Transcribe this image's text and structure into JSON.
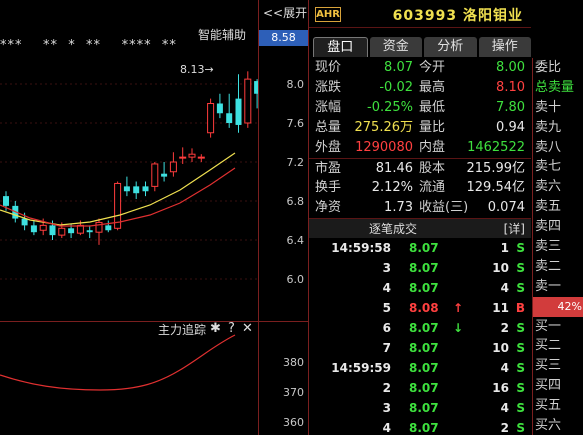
{
  "chart": {
    "indicator_label": "智能辅助",
    "star_row": "***    **  *  **    ****  **",
    "price_marker": "8.13→",
    "current_price_tag": "8.58",
    "collapse_label": "<<展开",
    "y_labels": [
      "8.0",
      "7.6",
      "7.2",
      "6.8",
      "6.4",
      "6.0"
    ],
    "sub_title": "主力追踪",
    "sub_icons": [
      "gear-icon",
      "help-icon",
      "close-icon"
    ],
    "sub_icon_glyphs": [
      "✱",
      "?",
      "✕"
    ],
    "sub_y_labels": [
      "380",
      "370",
      "360"
    ],
    "colors": {
      "up": "#ff3c3c",
      "down": "#3ee0e0",
      "ma_yellow": "#f0e050",
      "ma_red": "#e03030",
      "grid": "#7a1f1f"
    }
  },
  "header": {
    "badge": "AHR",
    "stock_code": "603993",
    "stock_name": "洛阳钼业"
  },
  "tabs": [
    {
      "label": "盘口",
      "active": true
    },
    {
      "label": "资金",
      "active": false
    },
    {
      "label": "分析",
      "active": false
    },
    {
      "label": "操作",
      "active": false
    }
  ],
  "quote": {
    "rows": [
      {
        "l1": "现价",
        "v1": "8.07",
        "c1": "green",
        "l2": "今开",
        "v2": "8.00",
        "c2": "green"
      },
      {
        "l1": "涨跌",
        "v1": "-0.02",
        "c1": "green",
        "l2": "最高",
        "v2": "8.10",
        "c2": "red"
      },
      {
        "l1": "涨幅",
        "v1": "-0.25%",
        "c1": "green",
        "l2": "最低",
        "v2": "7.80",
        "c2": "green"
      },
      {
        "l1": "总量",
        "v1": "275.26万",
        "c1": "yellow",
        "l2": "量比",
        "v2": "0.94",
        "c2": "white"
      },
      {
        "l1": "外盘",
        "v1": "1290080",
        "c1": "red",
        "l2": "内盘",
        "v2": "1462522",
        "c2": "green"
      },
      {
        "l1": "市盈",
        "v1": "81.46",
        "c1": "white",
        "l2": "股本",
        "v2": "215.99亿",
        "c2": "white"
      },
      {
        "l1": "换手",
        "v1": "2.12%",
        "c1": "white",
        "l2": "流通",
        "v2": "129.54亿",
        "c2": "white"
      },
      {
        "l1": "净资",
        "v1": "1.73",
        "c1": "white",
        "l2": "收益(三)",
        "v2": "0.074",
        "c2": "white"
      }
    ]
  },
  "ticks": {
    "title": "逐笔成交",
    "detail_label": "[详]",
    "rows": [
      {
        "time": "14:59:58",
        "price": "8.07",
        "arrow": "",
        "vol": "1",
        "side": "S"
      },
      {
        "time": "3",
        "price": "8.07",
        "arrow": "",
        "vol": "10",
        "side": "S"
      },
      {
        "time": "4",
        "price": "8.07",
        "arrow": "",
        "vol": "4",
        "side": "S"
      },
      {
        "time": "5",
        "price": "8.08",
        "arrow": "↑",
        "vol": "11",
        "side": "B"
      },
      {
        "time": "6",
        "price": "8.07",
        "arrow": "↓",
        "vol": "2",
        "side": "S"
      },
      {
        "time": "7",
        "price": "8.07",
        "arrow": "",
        "vol": "10",
        "side": "S"
      },
      {
        "time": "14:59:59",
        "price": "8.07",
        "arrow": "",
        "vol": "4",
        "side": "S"
      },
      {
        "time": "2",
        "price": "8.07",
        "arrow": "",
        "vol": "16",
        "side": "S"
      },
      {
        "time": "3",
        "price": "8.07",
        "arrow": "",
        "vol": "4",
        "side": "S"
      },
      {
        "time": "4",
        "price": "8.07",
        "arrow": "",
        "vol": "2",
        "side": "S"
      }
    ]
  },
  "orderbook": {
    "labels": [
      "委比",
      "总卖量",
      "卖十",
      "卖九",
      "卖八",
      "卖七",
      "卖六",
      "卖五",
      "卖四",
      "卖三",
      "卖二",
      "卖一",
      "",
      "买一",
      "买二",
      "买三",
      "买四",
      "买五",
      "买六"
    ],
    "bar_text": "42%"
  }
}
